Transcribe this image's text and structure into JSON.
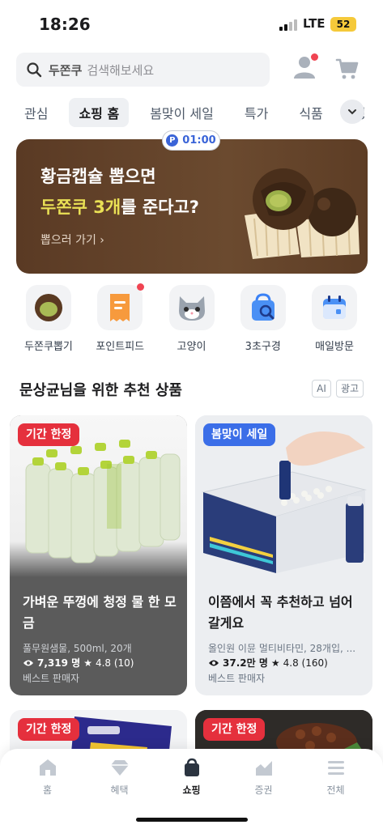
{
  "status_bar": {
    "time": "18:26",
    "network": "LTE",
    "battery": "52"
  },
  "search": {
    "keyword": "두쫀쿠",
    "placeholder": "검색해보세요"
  },
  "tabs": [
    {
      "label": "관심"
    },
    {
      "label": "쇼핑 홈",
      "active": true
    },
    {
      "label": "봄맞이 세일"
    },
    {
      "label": "특가"
    },
    {
      "label": "식품"
    },
    {
      "label": "생"
    }
  ],
  "banner": {
    "timer": "01:00",
    "line1": "황금캡슐 뽑으면",
    "line2_highlight": "두쫀쿠 3개",
    "line2_rest": "를 준다고?",
    "link": "뽑으러 가기 ›"
  },
  "quick_menu": [
    {
      "label": "두쫀쿠뽑기",
      "icon": "chocolate-ball-icon"
    },
    {
      "label": "포인트피드",
      "icon": "receipt-icon"
    },
    {
      "label": "고양이",
      "icon": "cat-icon"
    },
    {
      "label": "3초구경",
      "icon": "shopping-bag-search-icon"
    },
    {
      "label": "매일방문",
      "icon": "calendar-icon"
    }
  ],
  "recommend": {
    "title": "문상균님을 위한 추천 상품",
    "tag_ai": "AI",
    "tag_ad": "광고"
  },
  "products": [
    {
      "badge": "기간 한정",
      "title": "가벼운 뚜껑에 청정 물 한 모금",
      "subtitle": "풀무원샘물, 500ml, 20개",
      "views": "7,319 명",
      "rating": "4.8 (10)",
      "seller": "베스트 판매자"
    },
    {
      "badge": "봄맞이 세일",
      "title": "이쯤에서 꼭 추천하고 넘어갈게요",
      "subtitle": "올인원 이뮨 멀티비타민, 28개입, ...",
      "views": "37.2만 명",
      "rating": "4.8 (160)",
      "seller": "베스트 판매자"
    },
    {
      "badge": "기간 한정"
    },
    {
      "badge": "기간 한정"
    }
  ],
  "bottom_nav": [
    {
      "label": "홈",
      "icon": "home-icon"
    },
    {
      "label": "혜택",
      "icon": "diamond-icon"
    },
    {
      "label": "쇼핑",
      "icon": "shopping-bag-icon",
      "active": true
    },
    {
      "label": "증권",
      "icon": "chart-icon"
    },
    {
      "label": "전체",
      "icon": "menu-icon"
    }
  ],
  "colors": {
    "accent_red": "#e5303d",
    "accent_blue": "#3b6ee8",
    "banner_bg": "#5a3a24",
    "highlight": "#e9e055"
  }
}
